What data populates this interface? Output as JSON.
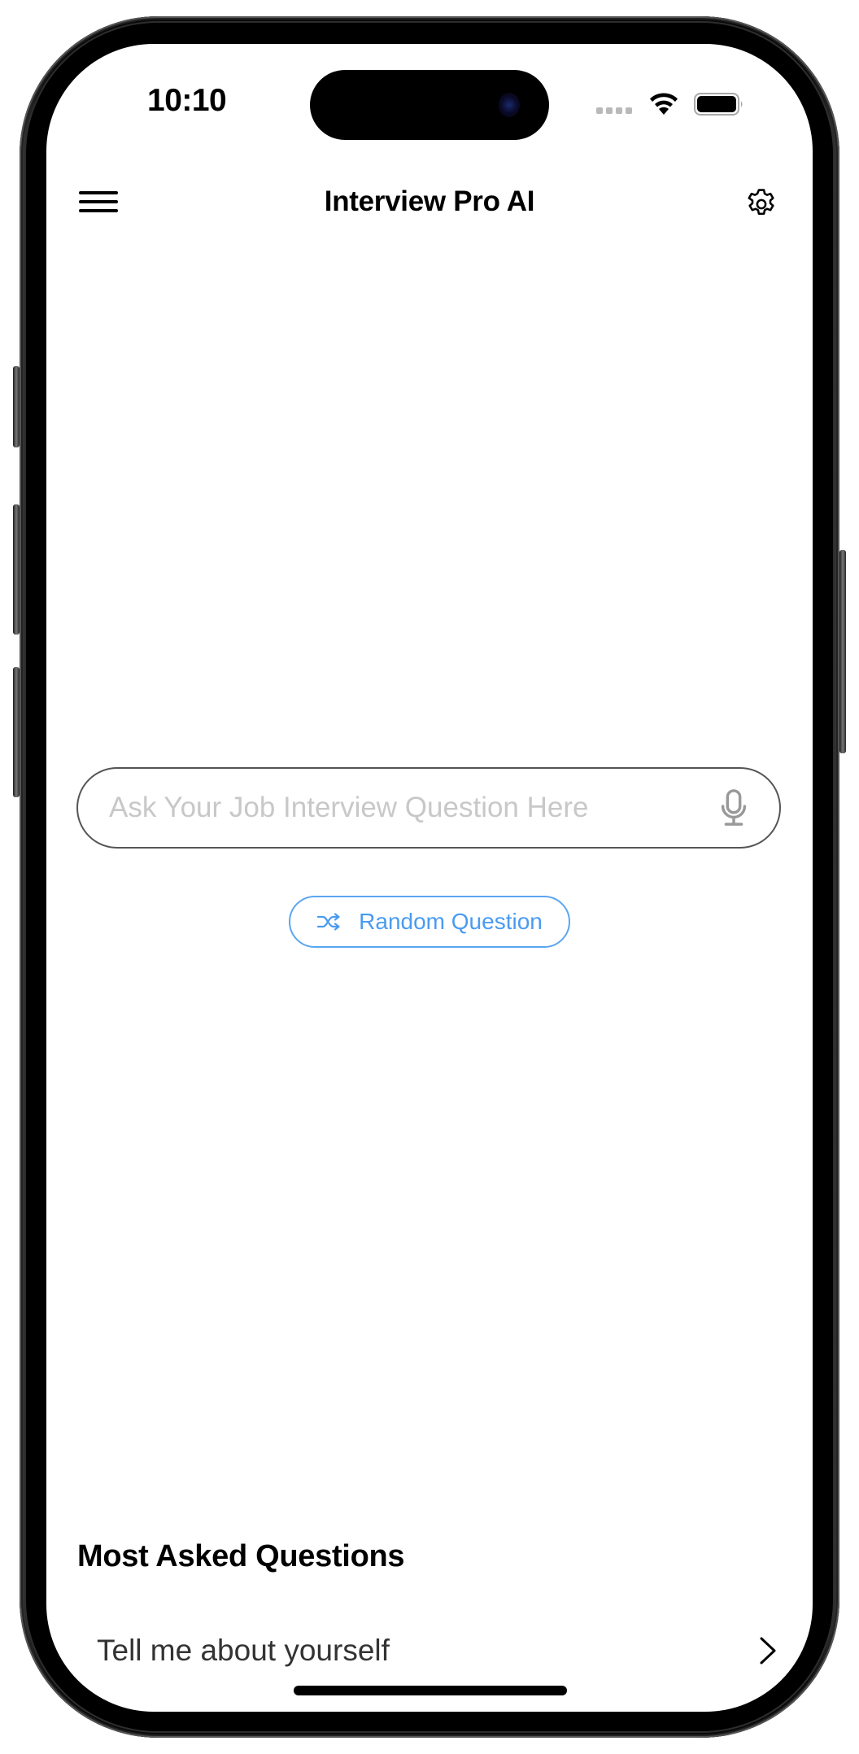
{
  "status_bar": {
    "time": "10:10",
    "icons": [
      "signal-dots-icon",
      "wifi-icon",
      "battery-icon"
    ]
  },
  "nav": {
    "title": "Interview Pro AI",
    "left_icon": "menu-icon",
    "right_icon": "gear-icon"
  },
  "search": {
    "value": "",
    "placeholder": "Ask Your Job Interview Question Here",
    "icon": "microphone-icon"
  },
  "random_button": {
    "label": "Random Question",
    "icon": "shuffle-icon",
    "color": "#4a9bf0"
  },
  "most_asked": {
    "title": "Most Asked Questions",
    "items": [
      {
        "label": "Tell me about yourself",
        "icon": "chevron-right-icon"
      }
    ]
  }
}
